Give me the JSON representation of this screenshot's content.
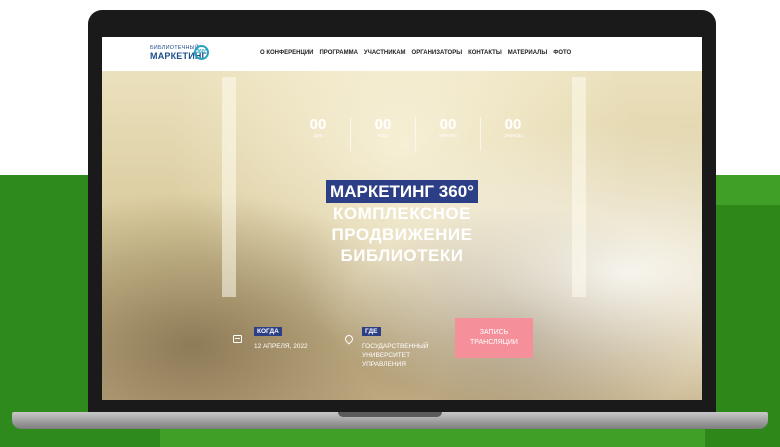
{
  "logo": {
    "line1": "БИБЛИОТЕЧНЫЙ",
    "line2": "МАРКЕТИНГ",
    "ring": "360°"
  },
  "nav": {
    "items": [
      "О КОНФЕРЕНЦИИ",
      "ПРОГРАММА",
      "УЧАСТНИКАМ",
      "ОРГАНИЗАТОРЫ",
      "КОНТАКТЫ",
      "МАТЕРИАЛЫ",
      "ФОТО"
    ]
  },
  "countdown": [
    {
      "value": "00",
      "label": "дни"
    },
    {
      "value": "00",
      "label": "часы"
    },
    {
      "value": "00",
      "label": "минуты"
    },
    {
      "value": "00",
      "label": "секунды"
    }
  ],
  "hero": {
    "title_highlight": "МАРКЕТИНГ 360°",
    "title_lines": [
      "КОМПЛЕКСНОЕ",
      "ПРОДВИЖЕНИЕ",
      "БИБЛИОТЕКИ"
    ]
  },
  "when": {
    "badge": "КОГДА",
    "value": "12 АПРЕЛЯ, 2022"
  },
  "where": {
    "badge": "ГДЕ",
    "value_lines": [
      "ГОСУДАРСТВЕННЫЙ",
      "УНИВЕРСИТЕТ",
      "УПРАВЛЕНИЯ"
    ]
  },
  "cta": {
    "lines": [
      "ЗАПИСЬ",
      "ТРАНСЛЯЦИИ"
    ]
  },
  "colors": {
    "brand_blue": "#2c3f86",
    "cta_pink": "#f5909a",
    "green": "#3f9f27"
  },
  "icons": {
    "when": "calendar-icon",
    "where": "map-pin-icon"
  }
}
